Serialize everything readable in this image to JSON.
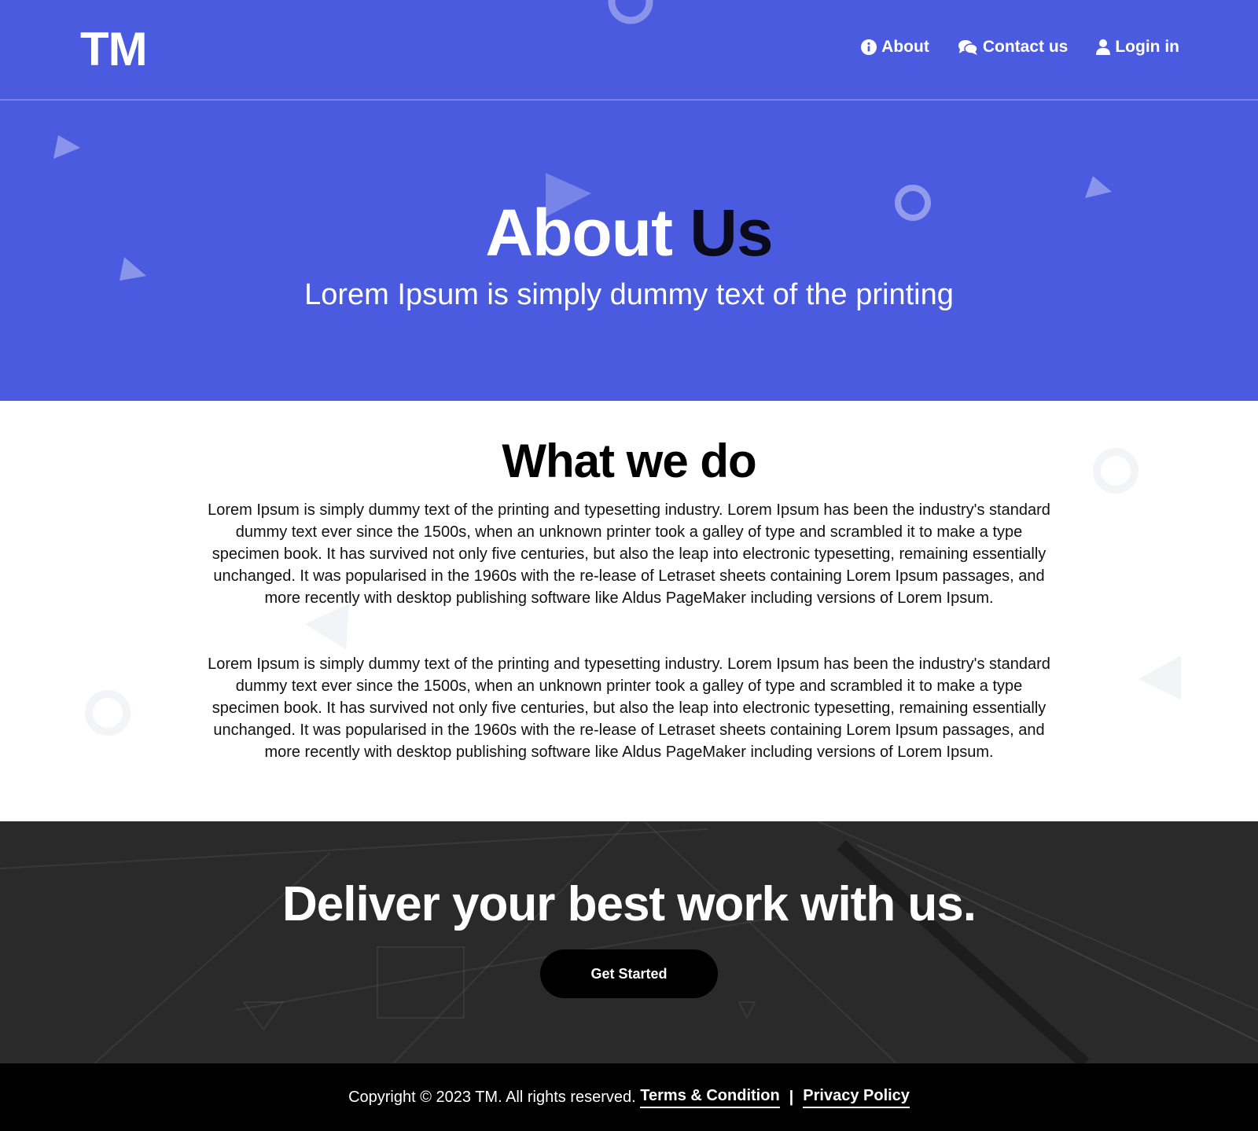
{
  "colors": {
    "primary": "#4b5bdf",
    "hero_dark": "#0b0b1c",
    "footer_bg": "#000000",
    "cta_bg": "#2f2f2f"
  },
  "header": {
    "logo": "TM",
    "nav": [
      {
        "label": "About",
        "icon": "info-circle-icon"
      },
      {
        "label": "Contact us",
        "icon": "chat-bubbles-icon"
      },
      {
        "label": "Login in",
        "icon": "user-icon"
      }
    ]
  },
  "hero": {
    "title_light": "About",
    "title_dark": "Us",
    "subtitle": "Lorem Ipsum is simply dummy text of the printing"
  },
  "about": {
    "title": "What we do",
    "paragraphs": [
      "Lorem Ipsum is simply dummy text of the printing and typesetting industry. Lorem Ipsum has been the industry's standard dummy text ever since the 1500s, when an unknown printer took a galley of type and scrambled it to make a type specimen book. It has survived not only five centuries, but also the leap into electronic typesetting, remaining essentially unchanged. It was popularised in the 1960s with the re-lease of Letraset sheets containing Lorem Ipsum passages, and more recently with desktop publishing software like Aldus PageMaker including versions of Lorem Ipsum.",
      "Lorem Ipsum is simply dummy text of the printing and typesetting industry. Lorem Ipsum has been the industry's standard dummy text ever since the 1500s, when an unknown printer took a galley of type and scrambled it to make a type specimen book. It has survived not only five centuries, but also the leap into electronic typesetting, remaining essentially unchanged. It was popularised in the 1960s with the re-lease of Letraset sheets containing Lorem Ipsum passages, and more recently with desktop publishing software like Aldus PageMaker including versions of Lorem Ipsum."
    ]
  },
  "cta": {
    "title": "Deliver your best work with us.",
    "button": "Get Started"
  },
  "footer": {
    "copyright": "Copyright ©  2023 TM. All rights reserved.",
    "terms": "Terms & Condition",
    "separator": "|",
    "privacy": "Privacy Policy"
  }
}
